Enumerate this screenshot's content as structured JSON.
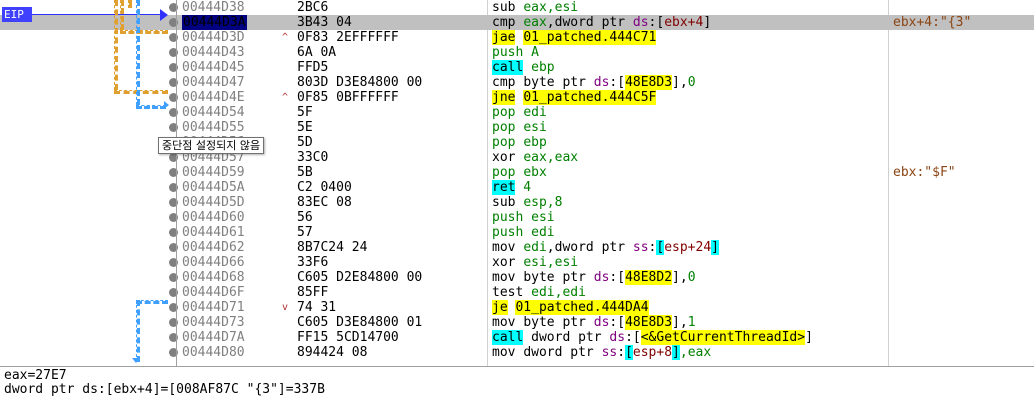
{
  "eip_label": "EIP",
  "tooltip": "중단점 설정되지 않음",
  "rows": [
    {
      "addr": "00444D38",
      "bytes": "2BC6",
      "instr": [
        {
          "t": "sub ",
          "c": "mn"
        },
        {
          "t": "eax,esi",
          "c": "reg"
        }
      ],
      "comment": "",
      "cur": false,
      "mark": ""
    },
    {
      "addr": "00444D3A",
      "bytes": "3B43 04",
      "instr": [
        {
          "t": "cmp ",
          "c": "mn"
        },
        {
          "t": "eax",
          "c": "reg"
        },
        {
          "t": ",dword ptr ",
          "c": "opnd"
        },
        {
          "t": "ds",
          "c": "seg"
        },
        {
          "t": ":[",
          "c": "opnd"
        },
        {
          "t": "ebx+4",
          "c": "mem"
        },
        {
          "t": "]",
          "c": "opnd"
        }
      ],
      "comment": "ebx+4:\"{3\"",
      "cur": true,
      "mark": ""
    },
    {
      "addr": "00444D3D",
      "bytes": "0F83 2EFFFFFF",
      "instr": [
        {
          "t": "jae",
          "c": "mn-jmp"
        },
        {
          "t": " ",
          "c": "opnd"
        },
        {
          "t": "01_patched.444C71",
          "c": "tgt"
        }
      ],
      "comment": "",
      "cur": false,
      "mark": "^"
    },
    {
      "addr": "00444D43",
      "bytes": "6A 0A",
      "instr": [
        {
          "t": "push ",
          "c": "mn-push"
        },
        {
          "t": "A",
          "c": "imm"
        }
      ],
      "comment": "",
      "cur": false,
      "mark": ""
    },
    {
      "addr": "00444D45",
      "bytes": "FFD5",
      "instr": [
        {
          "t": "call",
          "c": "mn-call"
        },
        {
          "t": " ebp",
          "c": "reg"
        }
      ],
      "comment": "",
      "cur": false,
      "mark": ""
    },
    {
      "addr": "00444D47",
      "bytes": "803D D3E84800 00",
      "instr": [
        {
          "t": "cmp ",
          "c": "mn"
        },
        {
          "t": "byte ptr ",
          "c": "opnd"
        },
        {
          "t": "ds",
          "c": "seg"
        },
        {
          "t": ":[",
          "c": "opnd"
        },
        {
          "t": "48E8D3",
          "c": "memhl"
        },
        {
          "t": "],",
          "c": "opnd"
        },
        {
          "t": "0",
          "c": "imm"
        }
      ],
      "comment": "",
      "cur": false,
      "mark": ""
    },
    {
      "addr": "00444D4E",
      "bytes": "0F85 0BFFFFFF",
      "instr": [
        {
          "t": "jne",
          "c": "mn-jmp"
        },
        {
          "t": " ",
          "c": "opnd"
        },
        {
          "t": "01_patched.444C5F",
          "c": "tgt"
        }
      ],
      "comment": "",
      "cur": false,
      "mark": "^"
    },
    {
      "addr": "00444D54",
      "bytes": "5F",
      "instr": [
        {
          "t": "pop ",
          "c": "mn-push"
        },
        {
          "t": "edi",
          "c": "reg"
        }
      ],
      "comment": "",
      "cur": false,
      "mark": ""
    },
    {
      "addr": "00444D55",
      "bytes": "5E",
      "instr": [
        {
          "t": "pop ",
          "c": "mn-push"
        },
        {
          "t": "esi",
          "c": "reg"
        }
      ],
      "comment": "",
      "cur": false,
      "mark": ""
    },
    {
      "addr": "00444D56",
      "bytes": "5D",
      "instr": [
        {
          "t": "pop ",
          "c": "mn-push"
        },
        {
          "t": "ebp",
          "c": "reg"
        }
      ],
      "comment": "",
      "cur": false,
      "mark": ""
    },
    {
      "addr": "00444D57",
      "bytes": "33C0",
      "instr": [
        {
          "t": "xor ",
          "c": "mn"
        },
        {
          "t": "eax,eax",
          "c": "reg"
        }
      ],
      "comment": "",
      "cur": false,
      "mark": ""
    },
    {
      "addr": "00444D59",
      "bytes": "5B",
      "instr": [
        {
          "t": "pop ",
          "c": "mn-push"
        },
        {
          "t": "ebx",
          "c": "reg"
        }
      ],
      "comment": "ebx:\"$F\"",
      "cur": false,
      "mark": ""
    },
    {
      "addr": "00444D5A",
      "bytes": "C2 0400",
      "instr": [
        {
          "t": "ret",
          "c": "mn-ret"
        },
        {
          "t": " 4",
          "c": "imm"
        }
      ],
      "comment": "",
      "cur": false,
      "mark": ""
    },
    {
      "addr": "00444D5D",
      "bytes": "83EC 08",
      "instr": [
        {
          "t": "sub ",
          "c": "mn"
        },
        {
          "t": "esp,8",
          "c": "reg"
        }
      ],
      "comment": "",
      "cur": false,
      "mark": ""
    },
    {
      "addr": "00444D60",
      "bytes": "56",
      "instr": [
        {
          "t": "push ",
          "c": "mn-push"
        },
        {
          "t": "esi",
          "c": "reg"
        }
      ],
      "comment": "",
      "cur": false,
      "mark": ""
    },
    {
      "addr": "00444D61",
      "bytes": "57",
      "instr": [
        {
          "t": "push ",
          "c": "mn-push"
        },
        {
          "t": "edi",
          "c": "reg"
        }
      ],
      "comment": "",
      "cur": false,
      "mark": ""
    },
    {
      "addr": "00444D62",
      "bytes": "8B7C24 24",
      "instr": [
        {
          "t": "mov ",
          "c": "mn"
        },
        {
          "t": "edi",
          "c": "reg"
        },
        {
          "t": ",dword ptr ",
          "c": "opnd"
        },
        {
          "t": "ss",
          "c": "seg"
        },
        {
          "t": ":",
          "c": "opnd"
        },
        {
          "t": "[",
          "c": "mn-call"
        },
        {
          "t": "esp+24",
          "c": "mem"
        },
        {
          "t": "]",
          "c": "mn-call"
        }
      ],
      "comment": "",
      "cur": false,
      "mark": ""
    },
    {
      "addr": "00444D66",
      "bytes": "33F6",
      "instr": [
        {
          "t": "xor ",
          "c": "mn"
        },
        {
          "t": "esi,esi",
          "c": "reg"
        }
      ],
      "comment": "",
      "cur": false,
      "mark": ""
    },
    {
      "addr": "00444D68",
      "bytes": "C605 D2E84800 00",
      "instr": [
        {
          "t": "mov ",
          "c": "mn"
        },
        {
          "t": "byte ptr ",
          "c": "opnd"
        },
        {
          "t": "ds",
          "c": "seg"
        },
        {
          "t": ":[",
          "c": "opnd"
        },
        {
          "t": "48E8D2",
          "c": "memhl"
        },
        {
          "t": "],",
          "c": "opnd"
        },
        {
          "t": "0",
          "c": "imm"
        }
      ],
      "comment": "",
      "cur": false,
      "mark": ""
    },
    {
      "addr": "00444D6F",
      "bytes": "85FF",
      "instr": [
        {
          "t": "test ",
          "c": "mn"
        },
        {
          "t": "edi,edi",
          "c": "reg"
        }
      ],
      "comment": "",
      "cur": false,
      "mark": ""
    },
    {
      "addr": "00444D71",
      "bytes": "74 31",
      "instr": [
        {
          "t": "je",
          "c": "mn-jmp"
        },
        {
          "t": " ",
          "c": "opnd"
        },
        {
          "t": "01_patched.444DA4",
          "c": "tgt"
        }
      ],
      "comment": "",
      "cur": false,
      "mark": "v"
    },
    {
      "addr": "00444D73",
      "bytes": "C605 D3E84800 01",
      "instr": [
        {
          "t": "mov ",
          "c": "mn"
        },
        {
          "t": "byte ptr ",
          "c": "opnd"
        },
        {
          "t": "ds",
          "c": "seg"
        },
        {
          "t": ":[",
          "c": "opnd"
        },
        {
          "t": "48E8D3",
          "c": "memhl"
        },
        {
          "t": "],",
          "c": "opnd"
        },
        {
          "t": "1",
          "c": "imm"
        }
      ],
      "comment": "",
      "cur": false,
      "mark": ""
    },
    {
      "addr": "00444D7A",
      "bytes": "FF15 5CD14700",
      "instr": [
        {
          "t": "call",
          "c": "mn-call"
        },
        {
          "t": " dword ptr ",
          "c": "opnd"
        },
        {
          "t": "ds",
          "c": "seg"
        },
        {
          "t": ":[",
          "c": "opnd"
        },
        {
          "t": "<&GetCurrentThreadId>",
          "c": "tgt"
        },
        {
          "t": "]",
          "c": "opnd"
        }
      ],
      "comment": "",
      "cur": false,
      "mark": ""
    },
    {
      "addr": "00444D80",
      "bytes": "894424 08",
      "instr": [
        {
          "t": "mov ",
          "c": "mn"
        },
        {
          "t": "dword ptr ",
          "c": "opnd"
        },
        {
          "t": "ss",
          "c": "seg"
        },
        {
          "t": ":",
          "c": "opnd"
        },
        {
          "t": "[",
          "c": "mn-call"
        },
        {
          "t": "esp+8",
          "c": "mem"
        },
        {
          "t": "]",
          "c": "mn-call"
        },
        {
          "t": ",eax",
          "c": "reg"
        }
      ],
      "comment": "",
      "cur": false,
      "mark": ""
    }
  ],
  "info": {
    "line1": "eax=27E7",
    "line2": "dword ptr ds:[ebx+4]=[008AF87C \"{3\"]=337B"
  }
}
